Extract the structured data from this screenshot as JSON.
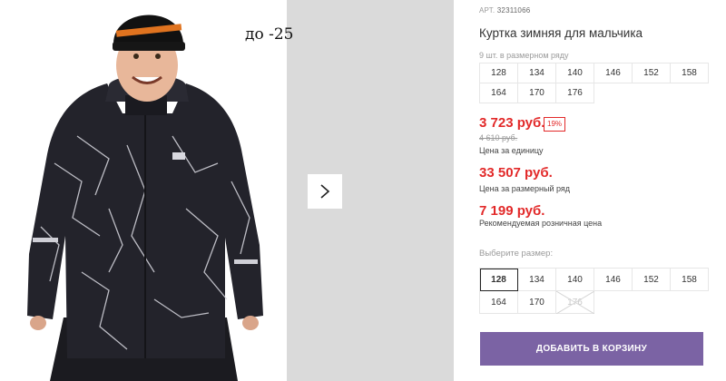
{
  "gallery": {
    "temperature_badge": "до -25",
    "next_icon": "chevron-right-icon",
    "colors": {
      "jacket": "#23232b",
      "pattern": "#d9d9e0",
      "hat": "#111111",
      "hat_stripe": "#e0731f",
      "skin": "#e8b79a"
    }
  },
  "product": {
    "sku_label": "АРТ.",
    "sku_value": "32311066",
    "title": "Куртка зимняя для мальчика"
  },
  "pack": {
    "label": "9 шт. в размерном ряду",
    "sizes": [
      "128",
      "134",
      "140",
      "146",
      "152",
      "158",
      "164",
      "170",
      "176"
    ]
  },
  "prices": {
    "unit_price": "3 723 руб.",
    "discount": "19%",
    "old_price": "4 610 руб.",
    "unit_note": "Цена за единицу",
    "pack_price": "33 507 руб.",
    "pack_note": "Цена за размерный ряд",
    "retail_price": "7 199 руб.",
    "retail_note": "Рекомендуемая розничная цена",
    "accent_color": "#e22929"
  },
  "size_picker": {
    "label": "Выберите размер:",
    "sizes": [
      {
        "value": "128",
        "state": "selected"
      },
      {
        "value": "134",
        "state": "available"
      },
      {
        "value": "140",
        "state": "available"
      },
      {
        "value": "146",
        "state": "available"
      },
      {
        "value": "152",
        "state": "available"
      },
      {
        "value": "158",
        "state": "available"
      },
      {
        "value": "164",
        "state": "available"
      },
      {
        "value": "170",
        "state": "available"
      },
      {
        "value": "176",
        "state": "unavailable"
      }
    ]
  },
  "cart": {
    "button_label": "ДОБАВИТЬ В КОРЗИНУ",
    "button_color": "#7b63a4"
  }
}
